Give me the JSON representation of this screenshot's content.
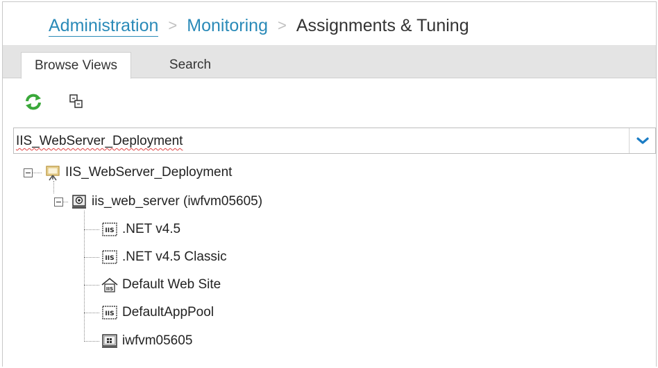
{
  "breadcrumb": {
    "items": [
      {
        "label": "Administration"
      },
      {
        "label": "Monitoring"
      },
      {
        "label": "Assignments & Tuning"
      }
    ],
    "separator": ">"
  },
  "tabs": [
    {
      "label": "Browse Views",
      "active": true
    },
    {
      "label": "Search",
      "active": false
    }
  ],
  "toolbar": {
    "refresh_icon": "refresh-icon",
    "expand_icon": "expand-all-icon"
  },
  "view_select": {
    "value": "IIS_WebServer_Deployment",
    "icon": "chevron-down-icon"
  },
  "tree": {
    "root": {
      "label": "IIS_WebServer_Deployment",
      "icon": "deployment-view-icon"
    },
    "server": {
      "label": "iis_web_server (iwfvm05605)",
      "icon": "server-icon"
    },
    "children": [
      {
        "label": ".NET v4.5",
        "icon": "iis-app-pool-icon"
      },
      {
        "label": ".NET v4.5 Classic",
        "icon": "iis-app-pool-icon"
      },
      {
        "label": "Default Web Site",
        "icon": "iis-web-site-icon"
      },
      {
        "label": "DefaultAppPool",
        "icon": "iis-app-pool-icon"
      },
      {
        "label": "iwfvm05605",
        "icon": "windows-node-icon"
      }
    ]
  },
  "colors": {
    "link": "#2a8ab8",
    "refresh_green": "#3aa83a",
    "chevron_blue": "#1a7cc4",
    "tabbar_bg": "#e4e4e4"
  }
}
